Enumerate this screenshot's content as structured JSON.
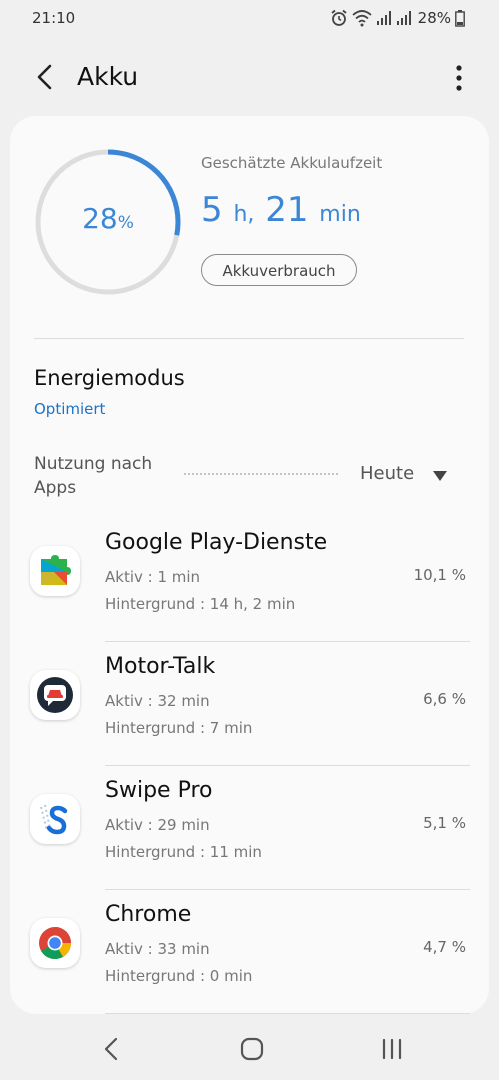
{
  "status_bar": {
    "time": "21:10",
    "battery_percent": "28%",
    "icons": [
      "alarm-icon",
      "wifi-icon",
      "signal-icon",
      "signal-icon",
      "battery-icon"
    ]
  },
  "app_bar": {
    "title": "Akku",
    "icons": [
      "back-arrow-icon",
      "more-vertical-icon"
    ]
  },
  "battery": {
    "level_value": "28",
    "level_unit": "%",
    "level_fraction": 0.28,
    "estimated_label": "Geschätzte Akkulaufzeit",
    "estimated_hours": "5",
    "hours_unit": "h,",
    "estimated_minutes": "21",
    "minutes_unit": "min",
    "usage_button": "Akkuverbrauch"
  },
  "power_mode": {
    "title": "Energiemodus",
    "value": "Optimiert"
  },
  "usage_by_apps": {
    "label": "Nutzung nach Apps",
    "period": "Heute",
    "apps": [
      {
        "name": "Google Play-Dienste",
        "active": "Aktiv : 1 min",
        "background": "Hintergrund : 14 h, 2 min",
        "percent": "10,1 %",
        "icon": "google-play-services-icon"
      },
      {
        "name": "Motor-Talk",
        "active": "Aktiv : 32 min",
        "background": "Hintergrund : 7 min",
        "percent": "6,6 %",
        "icon": "motor-talk-icon"
      },
      {
        "name": "Swipe Pro",
        "active": "Aktiv : 29 min",
        "background": "Hintergrund : 11 min",
        "percent": "5,1 %",
        "icon": "swipe-pro-icon"
      },
      {
        "name": "Chrome",
        "active": "Aktiv : 33 min",
        "background": "Hintergrund : 0 min",
        "percent": "4,7 %",
        "icon": "chrome-icon"
      }
    ]
  },
  "nav_bar": {
    "icons": [
      "nav-back-icon",
      "nav-home-icon",
      "nav-recents-icon"
    ]
  },
  "colors": {
    "accent": "#3b87d6",
    "link": "#1a73c8",
    "ring_track": "#dddddd"
  }
}
